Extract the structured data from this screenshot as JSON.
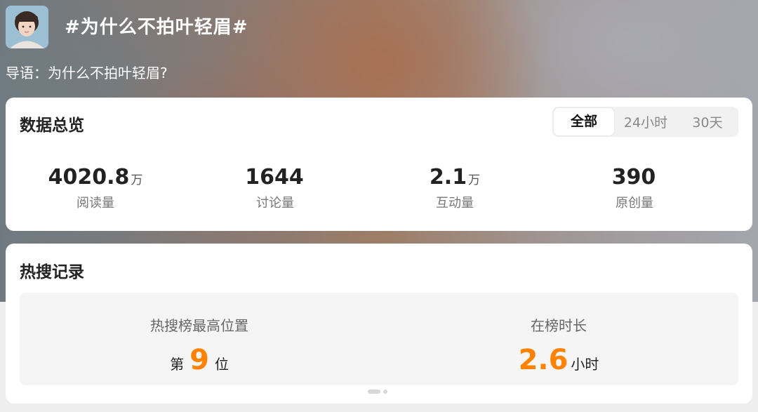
{
  "header": {
    "topic": "#为什么不拍叶轻眉#",
    "guide": "导语：为什么不拍叶轻眉?"
  },
  "overview": {
    "title": "数据总览",
    "tabs": [
      {
        "label": "全部",
        "active": true
      },
      {
        "label": "24小时",
        "active": false
      },
      {
        "label": "30天",
        "active": false
      }
    ],
    "stats": [
      {
        "value": "4020.8",
        "unit": "万",
        "label": "阅读量"
      },
      {
        "value": "1644",
        "unit": "",
        "label": "讨论量"
      },
      {
        "value": "2.1",
        "unit": "万",
        "label": "互动量"
      },
      {
        "value": "390",
        "unit": "",
        "label": "原创量"
      }
    ]
  },
  "hot": {
    "title": "热搜记录",
    "rank": {
      "label": "热搜榜最高位置",
      "prefix": "第",
      "value": "9",
      "suffix": "位"
    },
    "duration": {
      "label": "在榜时长",
      "value": "2.6",
      "unit": "小时"
    }
  },
  "colors": {
    "accent": "#ff8200"
  },
  "pagination": {
    "pages": 2,
    "current": 1
  }
}
